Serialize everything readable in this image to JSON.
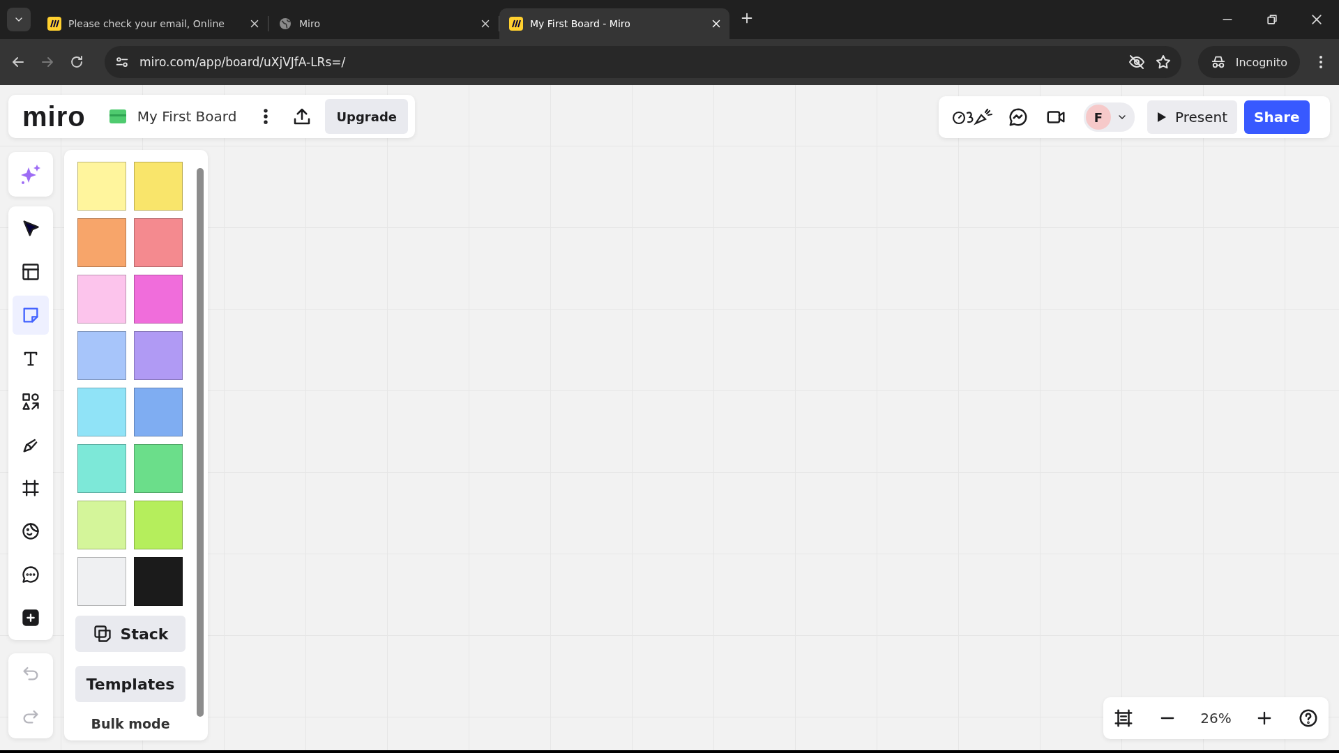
{
  "browser": {
    "tabs": [
      {
        "title": "Please check your email, Online",
        "kind": "miro",
        "selected": false
      },
      {
        "title": "Miro",
        "kind": "globe",
        "selected": false
      },
      {
        "title": "My First Board - Miro",
        "kind": "miro",
        "selected": true
      }
    ],
    "url": "miro.com/app/board/uXjVJfA-LRs=/",
    "profile": "Incognito"
  },
  "board": {
    "logo": "miro",
    "name": "My First Board",
    "upgrade": "Upgrade",
    "avatar": "F",
    "present": "Present",
    "share": "Share"
  },
  "toolbar": {
    "tools": [
      {
        "kind": "select",
        "selected": false
      },
      {
        "kind": "templates",
        "selected": false
      },
      {
        "kind": "sticky",
        "selected": true
      },
      {
        "kind": "text",
        "selected": false
      },
      {
        "kind": "shapes",
        "selected": false
      },
      {
        "kind": "pen",
        "selected": false
      },
      {
        "kind": "frame",
        "selected": false
      },
      {
        "kind": "stickers",
        "selected": false
      },
      {
        "kind": "comment",
        "selected": false
      },
      {
        "kind": "more",
        "selected": false
      }
    ],
    "undo_disabled": true,
    "redo_disabled": true
  },
  "sticky_panel": {
    "colors": [
      {
        "color": "#fff59d"
      },
      {
        "color": "#f9e56b"
      },
      {
        "color": "#f7a56a"
      },
      {
        "color": "#f48a8f"
      },
      {
        "color": "#fcc4ec"
      },
      {
        "color": "#f06ddb"
      },
      {
        "color": "#a7c5fa"
      },
      {
        "color": "#b09af4"
      },
      {
        "color": "#90e3f7"
      },
      {
        "color": "#7fadf2"
      },
      {
        "color": "#7de8d8"
      },
      {
        "color": "#6bde8a"
      },
      {
        "color": "#d4f59a"
      },
      {
        "color": "#b5ee5c"
      },
      {
        "color": "#eff0f2"
      },
      {
        "color": "#1b1b1b"
      }
    ],
    "stack": "Stack",
    "templates": "Templates",
    "bulk": "Bulk mode"
  },
  "zoom": {
    "level": "26%"
  }
}
